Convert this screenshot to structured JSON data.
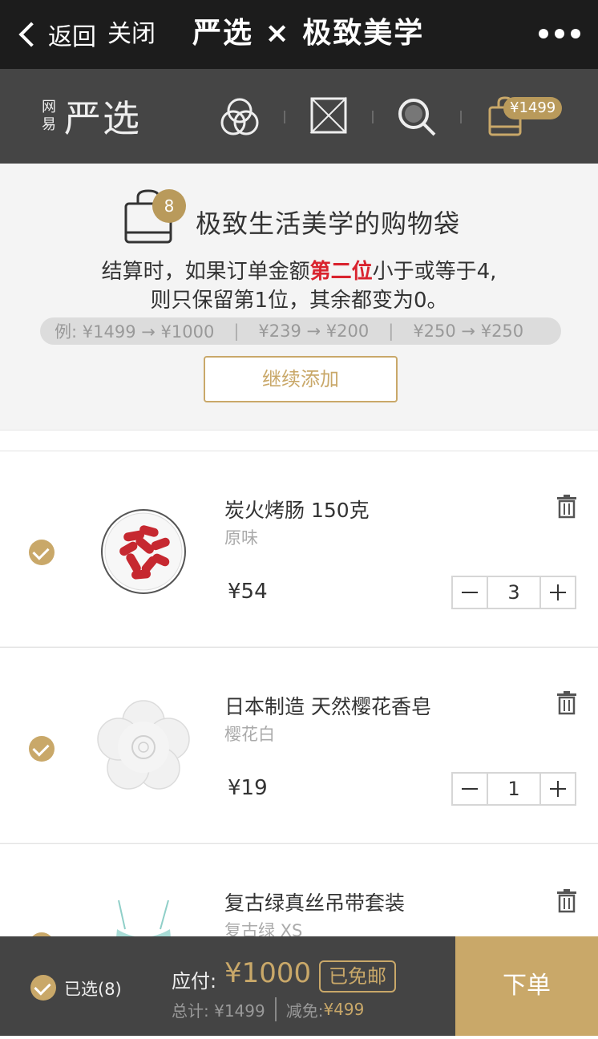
{
  "topbar": {
    "back_label": "返回",
    "close_label": "关闭",
    "title": "严选 × 极致美学"
  },
  "brandnav": {
    "logo_small_1": "网",
    "logo_small_2": "易",
    "logo_big": "严选",
    "cart_amount": "¥1499"
  },
  "promo": {
    "bag_count": "8",
    "title": "极致生活美学的购物袋",
    "line1_prefix": "结算时，如果订单金额",
    "line1_highlight": "第二位",
    "line1_suffix": "小于或等于4,",
    "line2": "则只保留第1位，其余都变为0。",
    "examples": [
      "例: ¥1499 → ¥1000",
      "¥239 → ¥200",
      "¥250 → ¥250"
    ],
    "continue_label": "继续添加"
  },
  "items": [
    {
      "name": "炭火烤肠 150克",
      "spec": "原味",
      "price": "¥54",
      "qty": "3"
    },
    {
      "name": "日本制造 天然樱花香皂",
      "spec": "樱花白",
      "price": "¥19",
      "qty": "1"
    },
    {
      "name": "复古绿真丝吊带套装",
      "spec": "复古绿 XS",
      "price": "",
      "qty": ""
    }
  ],
  "bottombar": {
    "selected_label": "已选(8)",
    "payable_label": "应付:",
    "payable_amount": "¥1000",
    "free_shipping": "已免邮",
    "total_label": "总计: ¥1499",
    "discount_label": "减免:",
    "discount_amount": "¥499",
    "order_label": "下单"
  },
  "colors": {
    "gold": "#c9a869",
    "dark": "#1c1c1c",
    "nav": "#454545",
    "highlight": "#d9232e"
  }
}
